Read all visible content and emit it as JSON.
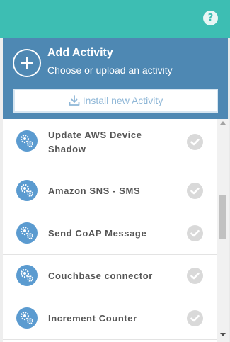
{
  "top_bar": {
    "help_label": "?",
    "color": "#3dbeb3"
  },
  "add_activity": {
    "title": "Add Activity",
    "subtitle": "Choose or upload an activity",
    "install_label": "Install new Activity",
    "plus_icon": "plus-circle-icon",
    "install_icon": "download-icon",
    "header_color": "#4e88b3"
  },
  "activities": [
    {
      "label": "Update AWS Device Shadow",
      "icon": "gears-icon",
      "status_icon": "check-icon"
    },
    {
      "label": "Amazon SNS - SMS",
      "icon": "gears-icon",
      "status_icon": "check-icon"
    },
    {
      "label": "Send CoAP Message",
      "icon": "gears-icon",
      "status_icon": "check-icon"
    },
    {
      "label": "Couchbase connector",
      "icon": "gears-icon",
      "status_icon": "check-icon"
    },
    {
      "label": "Increment Counter",
      "icon": "gears-icon",
      "status_icon": "check-icon"
    }
  ],
  "colors": {
    "icon_blue": "#5b9bd0",
    "check_gray": "#d9d9d9",
    "label_gray": "#555555"
  }
}
